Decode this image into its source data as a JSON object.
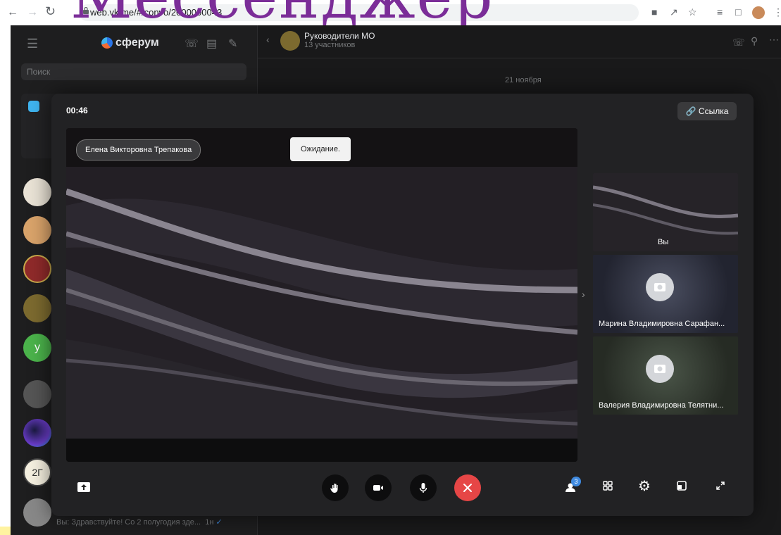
{
  "browser": {
    "url": "web.vk.me/#/convo/2000000043",
    "overlay_title": "Мессенджер"
  },
  "sidebar": {
    "brand": "сферум",
    "search_placeholder": "Поиск",
    "last_preview": "Вы: Здравствуйте! Со 2 полугодия зде...",
    "last_time": "1н"
  },
  "chat": {
    "title": "Руководители МО",
    "subtitle": "13 участников",
    "date_separator": "21 ноября"
  },
  "call": {
    "timer": "00:46",
    "link_label": "Ссылка",
    "speaker_name": "Елена Викторовна Трепакова",
    "status_tooltip": "Ожидание.",
    "participants_badge": "3",
    "tiles": [
      {
        "label": "Вы"
      },
      {
        "label": "Марина Владимировна Сарафан..."
      },
      {
        "label": "Валерия Владимировна Телятни..."
      }
    ]
  },
  "colors": {
    "end_call": "#e64646",
    "accent": "#3f8ae0"
  }
}
